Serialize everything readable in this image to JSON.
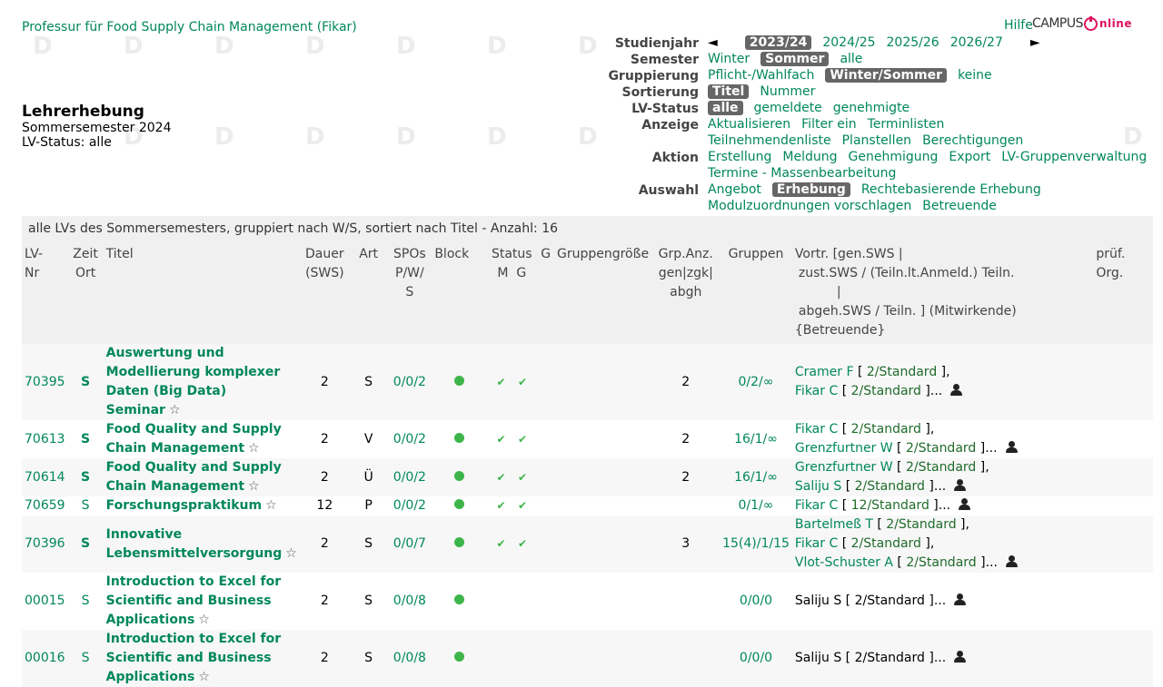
{
  "header": {
    "org": "Professur für Food Supply Chain Management (Fikar)",
    "help": "Hilfe",
    "logo_left": "CAMPUS",
    "logo_right": "nline",
    "title": "Lehrerhebung",
    "semester": "Sommersemester 2024",
    "status": "LV-Status: alle"
  },
  "filters": {
    "studienjahr": {
      "label": "Studienjahr",
      "prev": "◄",
      "next": "►",
      "options": [
        "2023/24",
        "2024/25",
        "2025/26",
        "2026/27"
      ]
    },
    "semester": {
      "label": "Semester",
      "options": [
        "Winter",
        "Sommer",
        "alle"
      ]
    },
    "gruppierung": {
      "label": "Gruppierung",
      "options": [
        "Pflicht-/Wahlfach",
        "Winter/Sommer",
        "keine"
      ]
    },
    "sortierung": {
      "label": "Sortierung",
      "options": [
        "Titel",
        "Nummer"
      ]
    },
    "lvstatus": {
      "label": "LV-Status",
      "options": [
        "alle",
        "gemeldete",
        "genehmigte"
      ]
    },
    "anzeige": {
      "label": "Anzeige",
      "row1": [
        "Aktualisieren",
        "Filter ein",
        "Terminlisten"
      ],
      "row2": [
        "Teilnehmendenliste",
        "Planstellen",
        "Berechtigungen"
      ]
    },
    "aktion": {
      "label": "Aktion",
      "row1": [
        "Erstellung",
        "Meldung",
        "Genehmigung",
        "Export",
        "LV-Gruppenverwaltung"
      ],
      "row2": [
        "Termine - Massenbearbeitung"
      ]
    },
    "auswahl": {
      "label": "Auswahl",
      "row1": [
        "Angebot",
        "Erhebung",
        "Rechtebasierende Erhebung"
      ],
      "row2": [
        "Modulzuordnungen vorschlagen",
        "Betreuende"
      ]
    }
  },
  "table": {
    "caption": "alle LVs des Sommersemesters, gruppiert nach W/S, sortiert nach Titel - Anzahl: 16",
    "headers": {
      "lvnr": [
        "LV-",
        "Nr"
      ],
      "zeit": [
        "Zeit",
        "Ort"
      ],
      "titel": "Titel",
      "dauer": [
        "Dauer",
        "(SWS)"
      ],
      "art": "Art",
      "spos": [
        "SPOs",
        "P/W/",
        "S"
      ],
      "block": "Block",
      "status": [
        "Status",
        "M  G"
      ],
      "g": "G",
      "gruppengroesse": "Gruppengröße",
      "grpanz": [
        "Grp.Anz.",
        "gen|zgk|",
        "abgh"
      ],
      "gruppen": "Gruppen",
      "vortr": [
        "Vortr. [gen.SWS |",
        "zust.SWS / (Teiln.lt.Anmeld.) Teiln.",
        "|",
        "abgeh.SWS / Teiln. ] (Mitwirkende) {Betreuende}"
      ],
      "pruef": [
        "prüf.",
        "Org."
      ]
    },
    "rows": [
      {
        "nr": "70395",
        "zeit": "S",
        "zeit_bold": true,
        "titel": "Auswertung und Modellierung komplexer Daten (Big Data) Seminar",
        "star": "☆",
        "dauer": "2",
        "art": "S",
        "spos": "0/0/2",
        "m": true,
        "g": true,
        "grpanz": "2",
        "gruppen": "0/2/∞",
        "lect": [
          {
            "name": "Cramer F",
            "std": "2/Standard",
            "end": " ],"
          },
          {
            "name": "Fikar C",
            "std": "2/Standard",
            "end": " ]..."
          }
        ]
      },
      {
        "nr": "70613",
        "zeit": "S",
        "zeit_bold": true,
        "titel": "Food Quality and Supply Chain Management",
        "star": "☆",
        "dauer": "2",
        "art": "V",
        "spos": "0/0/2",
        "m": true,
        "g": true,
        "grpanz": "2",
        "gruppen": "16/1/∞",
        "lect": [
          {
            "name": "Fikar C",
            "std": "2/Standard",
            "end": " ],"
          },
          {
            "name": "Grenzfurtner W",
            "std": "2/Standard",
            "end": " ]..."
          }
        ]
      },
      {
        "nr": "70614",
        "zeit": "S",
        "zeit_bold": true,
        "titel": "Food Quality and Supply Chain Management",
        "star": "☆",
        "dauer": "2",
        "art": "Ü",
        "spos": "0/0/2",
        "m": true,
        "g": true,
        "grpanz": "2",
        "gruppen": "16/1/∞",
        "lect": [
          {
            "name": "Grenzfurtner W",
            "std": "2/Standard",
            "end": " ],"
          },
          {
            "name": "Saliju S",
            "std": "2/Standard",
            "end": " ]..."
          }
        ]
      },
      {
        "nr": "70659",
        "zeit": "S",
        "zeit_bold": false,
        "titel": "Forschungspraktikum",
        "star": "☆",
        "dauer": "12",
        "art": "P",
        "spos": "0/0/2",
        "m": true,
        "g": true,
        "grpanz": "",
        "gruppen": "0/1/∞",
        "lect": [
          {
            "name": "Fikar C",
            "std": "12/Standard",
            "end": " ]..."
          }
        ]
      },
      {
        "nr": "70396",
        "zeit": "S",
        "zeit_bold": true,
        "titel": "Innovative Lebensmittelversorgung",
        "star": "☆",
        "dauer": "2",
        "art": "S",
        "spos": "0/0/7",
        "m": true,
        "g": true,
        "grpanz": "3",
        "gruppen": "15(4)/1/15",
        "lect": [
          {
            "name": "Bartelmeß T",
            "std": "2/Standard",
            "end": " ],"
          },
          {
            "name": "Fikar C",
            "std": "2/Standard",
            "end": " ],"
          },
          {
            "name": "Vlot-Schuster A",
            "std": "2/Standard",
            "end": " ]..."
          }
        ]
      },
      {
        "nr": "00015",
        "zeit": "S",
        "zeit_bold": false,
        "titel": "Introduction to Excel for Scientific and Business Applications",
        "star": "☆",
        "dauer": "2",
        "art": "S",
        "spos": "0/0/8",
        "m": true,
        "g": false,
        "grpanz": "",
        "gruppen": "0/0/0",
        "lect_plain": "Saliju S [ 2/Standard ]..."
      },
      {
        "nr": "00016",
        "zeit": "S",
        "zeit_bold": false,
        "titel": "Introduction to Excel for Scientific and Business Applications",
        "star": "☆",
        "dauer": "2",
        "art": "S",
        "spos": "0/0/8",
        "m": true,
        "g": false,
        "grpanz": "",
        "gruppen": "0/0/0",
        "lect_plain": "Saliju S [ 2/Standard ]..."
      }
    ]
  },
  "colors": {
    "link": "#00875a",
    "pill": "#666666",
    "status_ok": "#3db54a",
    "brand": "#e0115f"
  }
}
